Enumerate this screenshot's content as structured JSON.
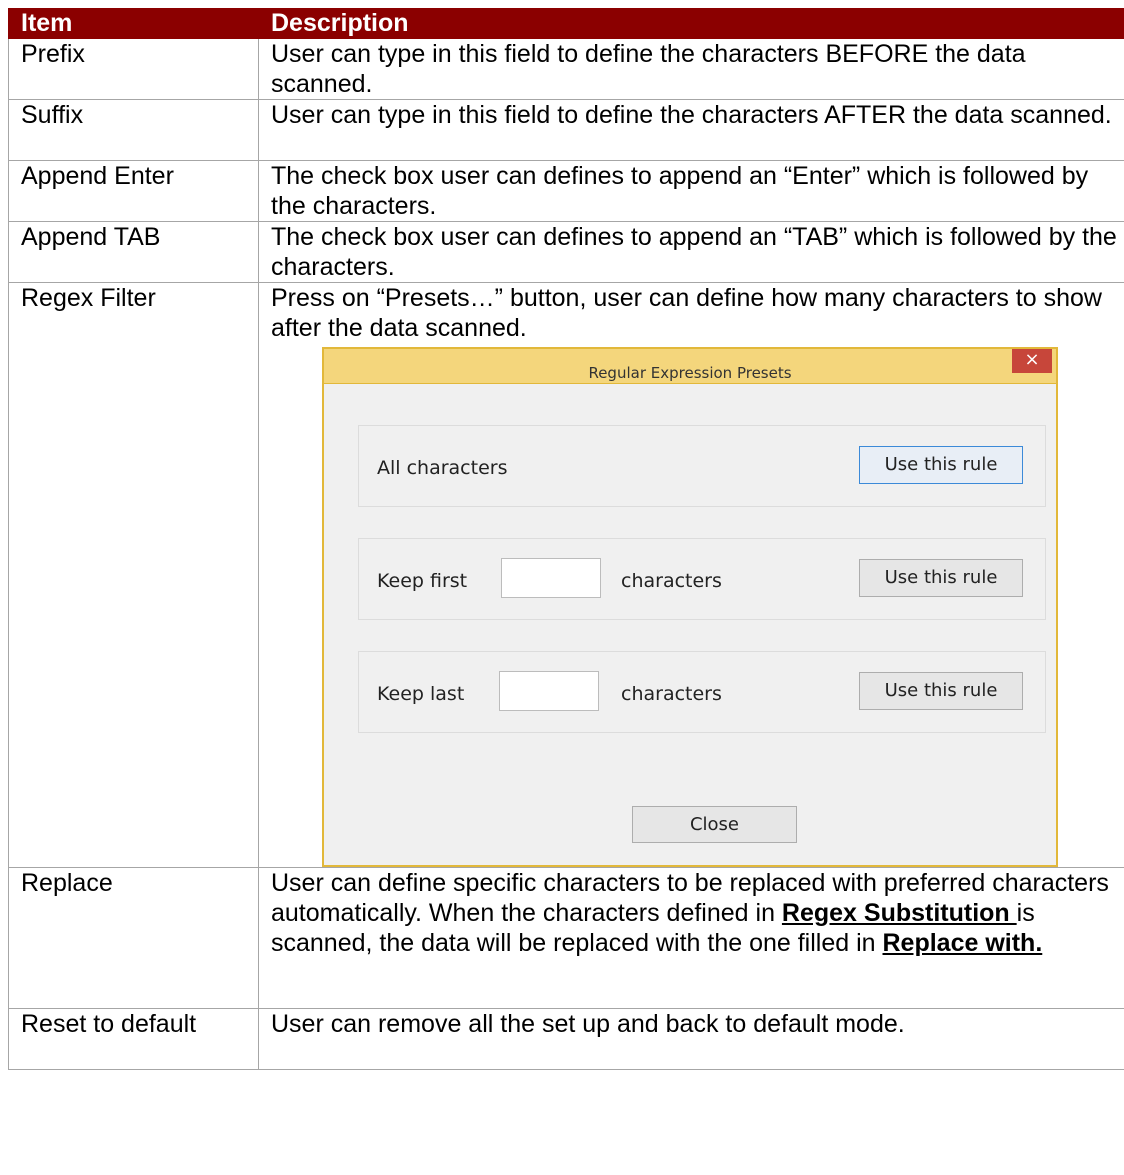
{
  "header": {
    "item": "Item",
    "description": "Description"
  },
  "rows": [
    {
      "item": "Prefix",
      "description": "User can type in this field to define the characters BEFORE the data scanned."
    },
    {
      "item": "Suffix",
      "description": "User can type in this field to define the characters AFTER the data scanned."
    },
    {
      "item": "Append Enter",
      "description": "The check box user can defines to append an “Enter” which is followed by the characters."
    },
    {
      "item": "Append TAB",
      "description": "The check box user can defines to append an “TAB” which is followed by the characters."
    },
    {
      "item": "Regex Filter",
      "description": "Press on “Presets…” button, user can define how many characters to show after the data scanned."
    },
    {
      "item": "Replace",
      "description_part1": "User can define specific characters to be replaced with preferred characters automatically. When the characters defined in ",
      "term1": "Regex Substitution ",
      "description_part2": "is scanned, the data will be replaced with the one filled in ",
      "term2": "Replace with."
    },
    {
      "item": "Reset to default",
      "description": "User can remove all the set up and back to default mode."
    }
  ],
  "dialog": {
    "title": "Regular Expression Presets",
    "close_glyph": "×",
    "rules": [
      {
        "label": "All characters",
        "button": "Use this rule"
      },
      {
        "label_before": "Keep first",
        "label_after": "characters",
        "button": "Use this rule"
      },
      {
        "label_before": "Keep last",
        "label_after": "characters",
        "button": "Use this rule"
      }
    ],
    "close_button": "Close"
  },
  "colors": {
    "header_bg": "#8b0000",
    "dialog_border": "#e2b83a",
    "close_x_bg": "#c7463a"
  }
}
